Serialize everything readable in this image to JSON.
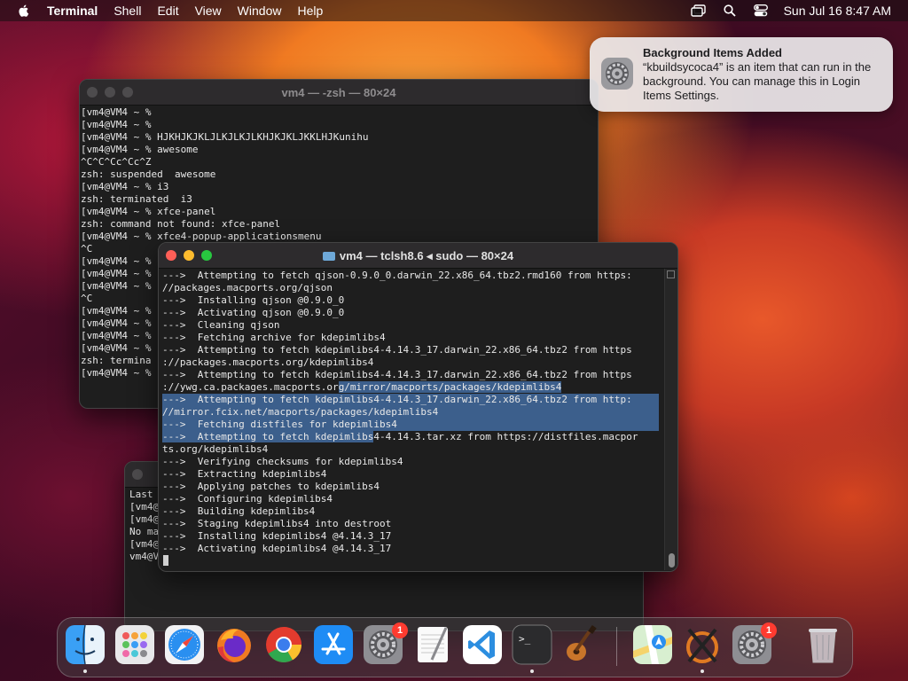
{
  "menubar": {
    "app": "Terminal",
    "items": [
      "Shell",
      "Edit",
      "View",
      "Window",
      "Help"
    ],
    "clock": "Sun Jul 16  8:47 AM"
  },
  "notification": {
    "title": "Background Items Added",
    "body": "“kbuildsycoca4” is an item that can run in the background. You can manage this in Login Items Settings."
  },
  "window_back": {
    "title": "vm4 — -zsh — 80×24",
    "lines": [
      "[vm4@VM4 ~ %",
      "[vm4@VM4 ~ %",
      "[vm4@VM4 ~ % HJKHJKJKLJLKJLKJLKHJKJKLJKKLHJKunihu",
      "[vm4@VM4 ~ % awesome",
      "^C^C^Cc^Cc^Z",
      "zsh: suspended  awesome",
      "[vm4@VM4 ~ % i3",
      "zsh: terminated  i3",
      "[vm4@VM4 ~ % xfce-panel",
      "zsh: command not found: xfce-panel",
      "[vm4@VM4 ~ % xfce4-popup-applicationsmenu",
      "^C",
      "[vm4@VM4 ~ %",
      "[vm4@VM4 ~ %",
      "[vm4@VM4 ~ %",
      "^C",
      "[vm4@VM4 ~ %",
      "[vm4@VM4 ~ %",
      "[vm4@VM4 ~ %",
      "[vm4@VM4 ~ %",
      "zsh: termina",
      "[vm4@VM4 ~ %"
    ]
  },
  "window_third": {
    "lines": [
      "Last",
      "[vm4@V",
      "[vm4@V",
      "No ma",
      "[vm4@V",
      "vm4@V"
    ]
  },
  "window_front": {
    "title": "vm4 — tclsh8.6 ◂ sudo — 80×24",
    "lines": [
      {
        "t": "--->  Attempting to fetch qjson-0.9.0_0.darwin_22.x86_64.tbz2.rmd160 from https:",
        "s": ""
      },
      {
        "t": "//packages.macports.org/qjson",
        "s": ""
      },
      {
        "t": "--->  Installing qjson @0.9.0_0",
        "s": ""
      },
      {
        "t": "--->  Activating qjson @0.9.0_0",
        "s": ""
      },
      {
        "t": "--->  Cleaning qjson",
        "s": ""
      },
      {
        "t": "--->  Fetching archive for kdepimlibs4",
        "s": ""
      },
      {
        "t": "--->  Attempting to fetch kdepimlibs4-4.14.3_17.darwin_22.x86_64.tbz2 from https",
        "s": ""
      },
      {
        "t": "://packages.macports.org/kdepimlibs4",
        "s": ""
      },
      {
        "t": "--->  Attempting to fetch kdepimlibs4-4.14.3_17.darwin_22.x86_64.tbz2 from https",
        "s": ""
      },
      {
        "t": "://ywg.ca.packages.macports.org/mirror/macports/packages/kdepimlibs4",
        "s": "tail"
      },
      {
        "t": "--->  Attempting to fetch kdepimlibs4-4.14.3_17.darwin_22.x86_64.tbz2 from http:",
        "s": "full"
      },
      {
        "t": "//mirror.fcix.net/macports/packages/kdepimlibs4",
        "s": "full"
      },
      {
        "t": "--->  Fetching distfiles for kdepimlibs4",
        "s": "full"
      },
      {
        "t": "--->  Attempting to fetch kdepimlibs4-4.14.3.tar.xz from https://distfiles.macpor",
        "s": "head"
      },
      {
        "t": "ts.org/kdepimlibs4",
        "s": ""
      },
      {
        "t": "--->  Verifying checksums for kdepimlibs4",
        "s": ""
      },
      {
        "t": "--->  Extracting kdepimlibs4",
        "s": ""
      },
      {
        "t": "--->  Applying patches to kdepimlibs4",
        "s": ""
      },
      {
        "t": "--->  Configuring kdepimlibs4",
        "s": ""
      },
      {
        "t": "--->  Building kdepimlibs4",
        "s": ""
      },
      {
        "t": "--->  Staging kdepimlibs4 into destroot",
        "s": ""
      },
      {
        "t": "--->  Installing kdepimlibs4 @4.14.3_17",
        "s": ""
      },
      {
        "t": "--->  Activating kdepimlibs4 @4.14.3_17",
        "s": ""
      }
    ]
  },
  "dock": {
    "apps": [
      {
        "name": "finder-icon",
        "running": true
      },
      {
        "name": "launchpad-icon",
        "running": false
      },
      {
        "name": "safari-icon",
        "running": false
      },
      {
        "name": "firefox-icon",
        "running": false
      },
      {
        "name": "chrome-icon",
        "running": false
      },
      {
        "name": "app-store-icon",
        "running": false
      },
      {
        "name": "system-settings-icon",
        "running": false,
        "badge": "1"
      },
      {
        "name": "textedit-icon",
        "running": false
      },
      {
        "name": "vscode-icon",
        "running": false
      },
      {
        "name": "terminal-icon",
        "running": true
      },
      {
        "name": "guitar-icon",
        "running": false
      },
      {
        "name": "maps-icon",
        "running": false
      },
      {
        "name": "xquartz-icon",
        "running": true
      },
      {
        "name": "system-settings-icon-2",
        "running": false,
        "badge": "1"
      },
      {
        "name": "trash-icon",
        "running": false
      }
    ]
  }
}
